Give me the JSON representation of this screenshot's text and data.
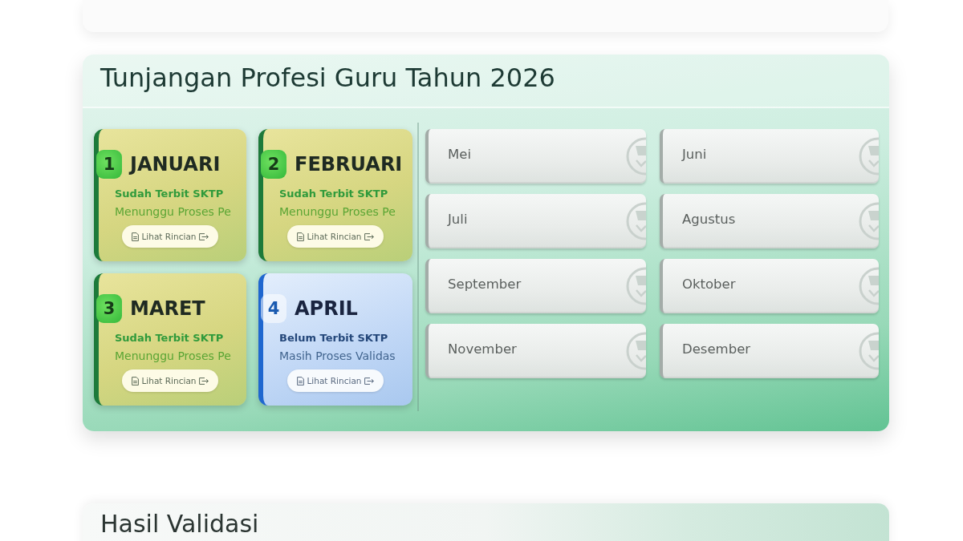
{
  "panel": {
    "title": "Tunjangan Profesi Guru Tahun 2026",
    "months": [
      {
        "number": "1",
        "name": "JANUARI",
        "kind": "published",
        "status": "Sudah Terbit SKTP",
        "note": "Menunggu Proses Pe",
        "button": "Lihat Rincian"
      },
      {
        "number": "2",
        "name": "FEBRUARI",
        "kind": "published",
        "status": "Sudah Terbit SKTP",
        "note": "Menunggu Proses Pe",
        "button": "Lihat Rincian"
      },
      {
        "number": "3",
        "name": "MARET",
        "kind": "published",
        "status": "Sudah Terbit SKTP",
        "note": "Menunggu Proses Pe",
        "button": "Lihat Rincian"
      },
      {
        "number": "4",
        "name": "APRIL",
        "kind": "pending",
        "status": "Belum Terbit SKTP",
        "note": "Masih Proses Validas",
        "button": "Lihat Rincian"
      }
    ],
    "later_months": [
      {
        "label": "Mei"
      },
      {
        "label": "Juni"
      },
      {
        "label": "Juli"
      },
      {
        "label": "Agustus"
      },
      {
        "label": "September"
      },
      {
        "label": "Oktober"
      },
      {
        "label": "November"
      },
      {
        "label": "Desember"
      }
    ]
  },
  "next_section": {
    "title": "Hasil Validasi"
  }
}
